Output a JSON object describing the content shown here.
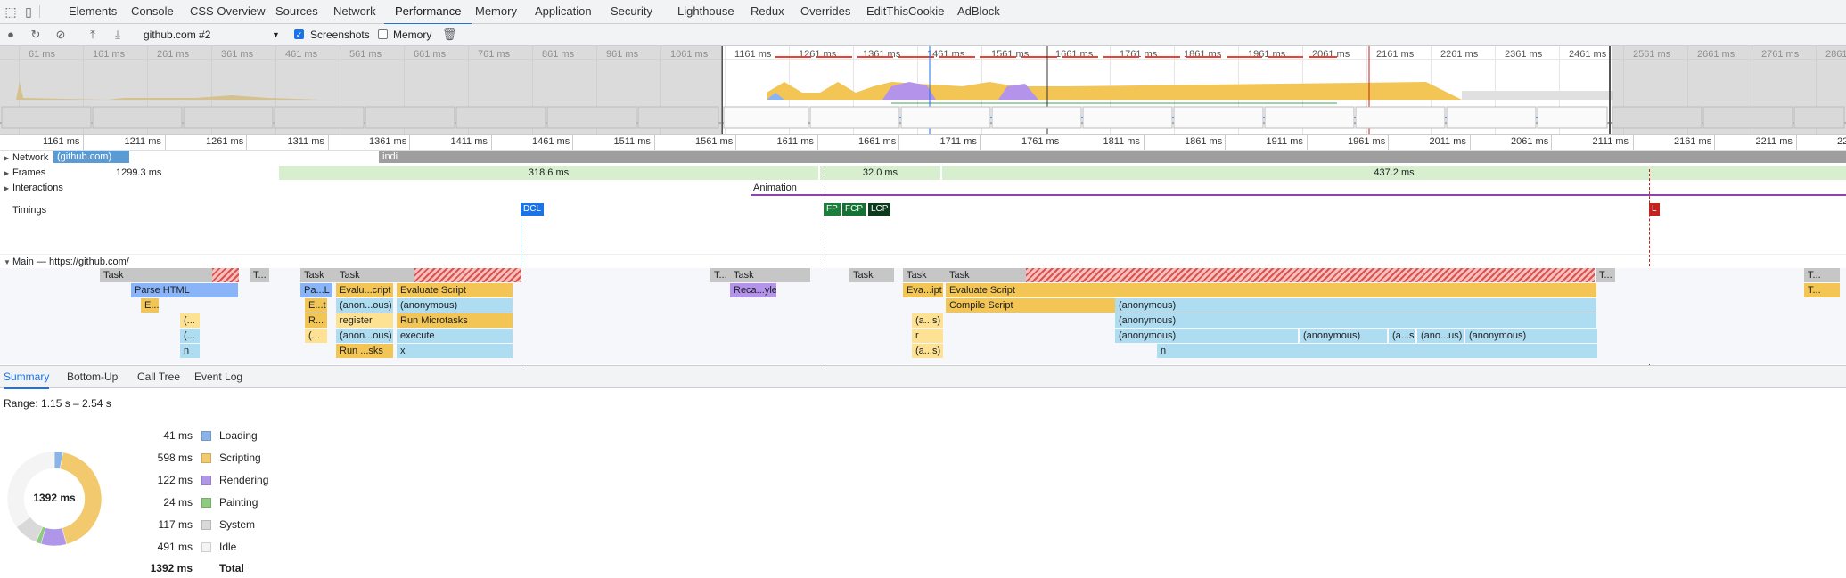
{
  "tabs": [
    "Elements",
    "Console",
    "CSS Overview",
    "Sources",
    "Network",
    "Performance",
    "Memory",
    "Application",
    "Security",
    "Lighthouse",
    "Redux",
    "Overrides",
    "EditThisCookie",
    "AdBlock"
  ],
  "toolbar": {
    "profile": "github.com #2",
    "screenshots_label": "Screenshots",
    "screenshots_checked": true,
    "memory_label": "Memory",
    "memory_checked": false
  },
  "overview_ticks": [
    "61 ms",
    "161 ms",
    "261 ms",
    "361 ms",
    "461 ms",
    "561 ms",
    "661 ms",
    "761 ms",
    "861 ms",
    "961 ms",
    "1061 ms",
    "1161 ms",
    "1261 ms",
    "1361 ms",
    "1461 ms",
    "1561 ms",
    "1661 ms",
    "1761 ms",
    "1861 ms",
    "1961 ms",
    "2061 ms",
    "2161 ms",
    "2261 ms",
    "2361 ms",
    "2461 ms",
    "2561 ms",
    "2661 ms",
    "2761 ms",
    "2861 ms"
  ],
  "ruler_ticks": [
    "1161 ms",
    "1211 ms",
    "1261 ms",
    "1311 ms",
    "1361 ms",
    "1411 ms",
    "1461 ms",
    "1511 ms",
    "1561 ms",
    "1611 ms",
    "1661 ms",
    "1711 ms",
    "1761 ms",
    "1811 ms",
    "1861 ms",
    "1911 ms",
    "1961 ms",
    "2011 ms",
    "2061 ms",
    "2111 ms",
    "2161 ms",
    "2211 ms",
    "221"
  ],
  "tracks": {
    "network": {
      "label": "Network",
      "request": "(github.com)",
      "indi": "indi"
    },
    "frames": {
      "label": "Frames",
      "values": [
        "1299.3 ms",
        "318.6 ms",
        "32.0 ms",
        "437.2 ms"
      ]
    },
    "interactions": {
      "label": "Interactions",
      "animation": "Animation"
    },
    "timings": {
      "label": "Timings",
      "markers": [
        {
          "text": "DCL",
          "color": "#1a73e8"
        },
        {
          "text": "FP",
          "color": "#188038"
        },
        {
          "text": "FCP",
          "color": "#137333"
        },
        {
          "text": "LCP",
          "color": "#0d3a1c"
        },
        {
          "text": "L",
          "color": "#c5221f"
        }
      ]
    },
    "main": {
      "label": "Main — https://github.com/"
    }
  },
  "flame": {
    "task": "Task",
    "t": "T...",
    "parse_html": "Parse HTML",
    "e": "E...",
    "paren": "(...",
    "n": "n",
    "pal": "Pa...L",
    "et": "E...t",
    "r": "R...",
    "paren2": "(...",
    "evalu_script": "Evalu...cript",
    "anon_ous": "(anon...ous)",
    "register": "register",
    "run_sks": "Run ...sks",
    "evaluate_script": "Evaluate Script",
    "anonymous": "(anonymous)",
    "run_microtasks": "Run Microtasks",
    "execute": "execute",
    "x": "x",
    "reca_yle": "Reca...yle",
    "eva_ipt": "Eva...ipt",
    "as": "(a...s)",
    "r2": "r",
    "as2": "(a...s)",
    "compile_script": "Compile Script",
    "a_s": "(a...s)",
    "ano_us": "(ano...us)",
    "i": "i",
    "t2": "T..."
  },
  "bottom_tabs": [
    "Summary",
    "Bottom-Up",
    "Call Tree",
    "Event Log"
  ],
  "summary": {
    "range": "Range: 1.15 s – 2.54 s",
    "center": "1392 ms",
    "items": [
      {
        "ms": "41 ms",
        "name": "Loading",
        "color": "#8ab4e8",
        "value": 41
      },
      {
        "ms": "598 ms",
        "name": "Scripting",
        "color": "#f2c96d",
        "value": 598
      },
      {
        "ms": "122 ms",
        "name": "Rendering",
        "color": "#af96e8",
        "value": 122
      },
      {
        "ms": "24 ms",
        "name": "Painting",
        "color": "#8fcb7f",
        "value": 24
      },
      {
        "ms": "117 ms",
        "name": "System",
        "color": "#d9d9d9",
        "value": 117
      },
      {
        "ms": "491 ms",
        "name": "Idle",
        "color": "#f4f4f4",
        "value": 491
      }
    ],
    "total_ms": "1392 ms",
    "total_label": "Total"
  }
}
